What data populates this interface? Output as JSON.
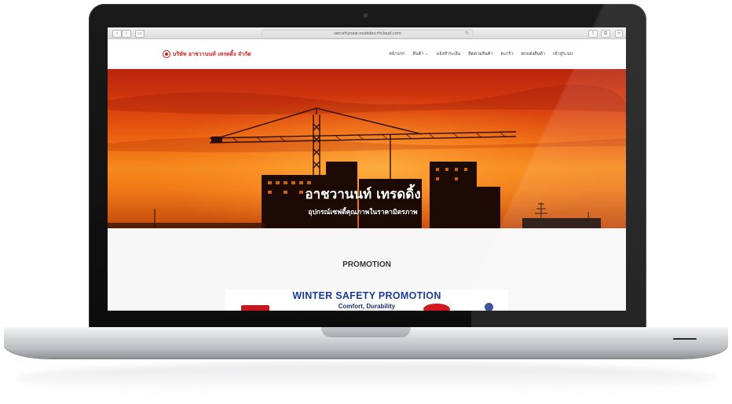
{
  "browser": {
    "url": "securitynew-nosbdev.rhcloud.com",
    "back_label": "‹",
    "forward_label": "›",
    "sidebar_label": "▭",
    "reload_label": "↻",
    "share_label": "⇧",
    "tabs_label": "⧉",
    "new_tab_label": "+"
  },
  "site": {
    "logo_text": "บริษัท อาชวานนท์ เทรดดิ้ง จำกัด",
    "logo_icon": "company-logo-icon",
    "menu": [
      {
        "label": "หน้าแรก"
      },
      {
        "label": "สินค้า ⌄"
      },
      {
        "label": "แจ้งชำระเงิน"
      },
      {
        "label": "ติดตามสินค้า"
      },
      {
        "label": "ตะกร้า"
      },
      {
        "label": "ตกแต่งสินค้า"
      },
      {
        "label": "เข้าสู่ระบบ"
      }
    ]
  },
  "hero": {
    "title": "อาชวานนท์ เทรดดิ้ง",
    "subtitle": "อุปกรณ์เซฟตี้คุณภาพในราคามิตรภาพ"
  },
  "section": {
    "title": "PROMOTION"
  },
  "promo": {
    "title": "WINTER SAFETY PROMOTION",
    "subtitle": "Comfort, Durability"
  },
  "colors": {
    "brand_red": "#d11b1b",
    "promo_blue": "#1b3b9c"
  }
}
